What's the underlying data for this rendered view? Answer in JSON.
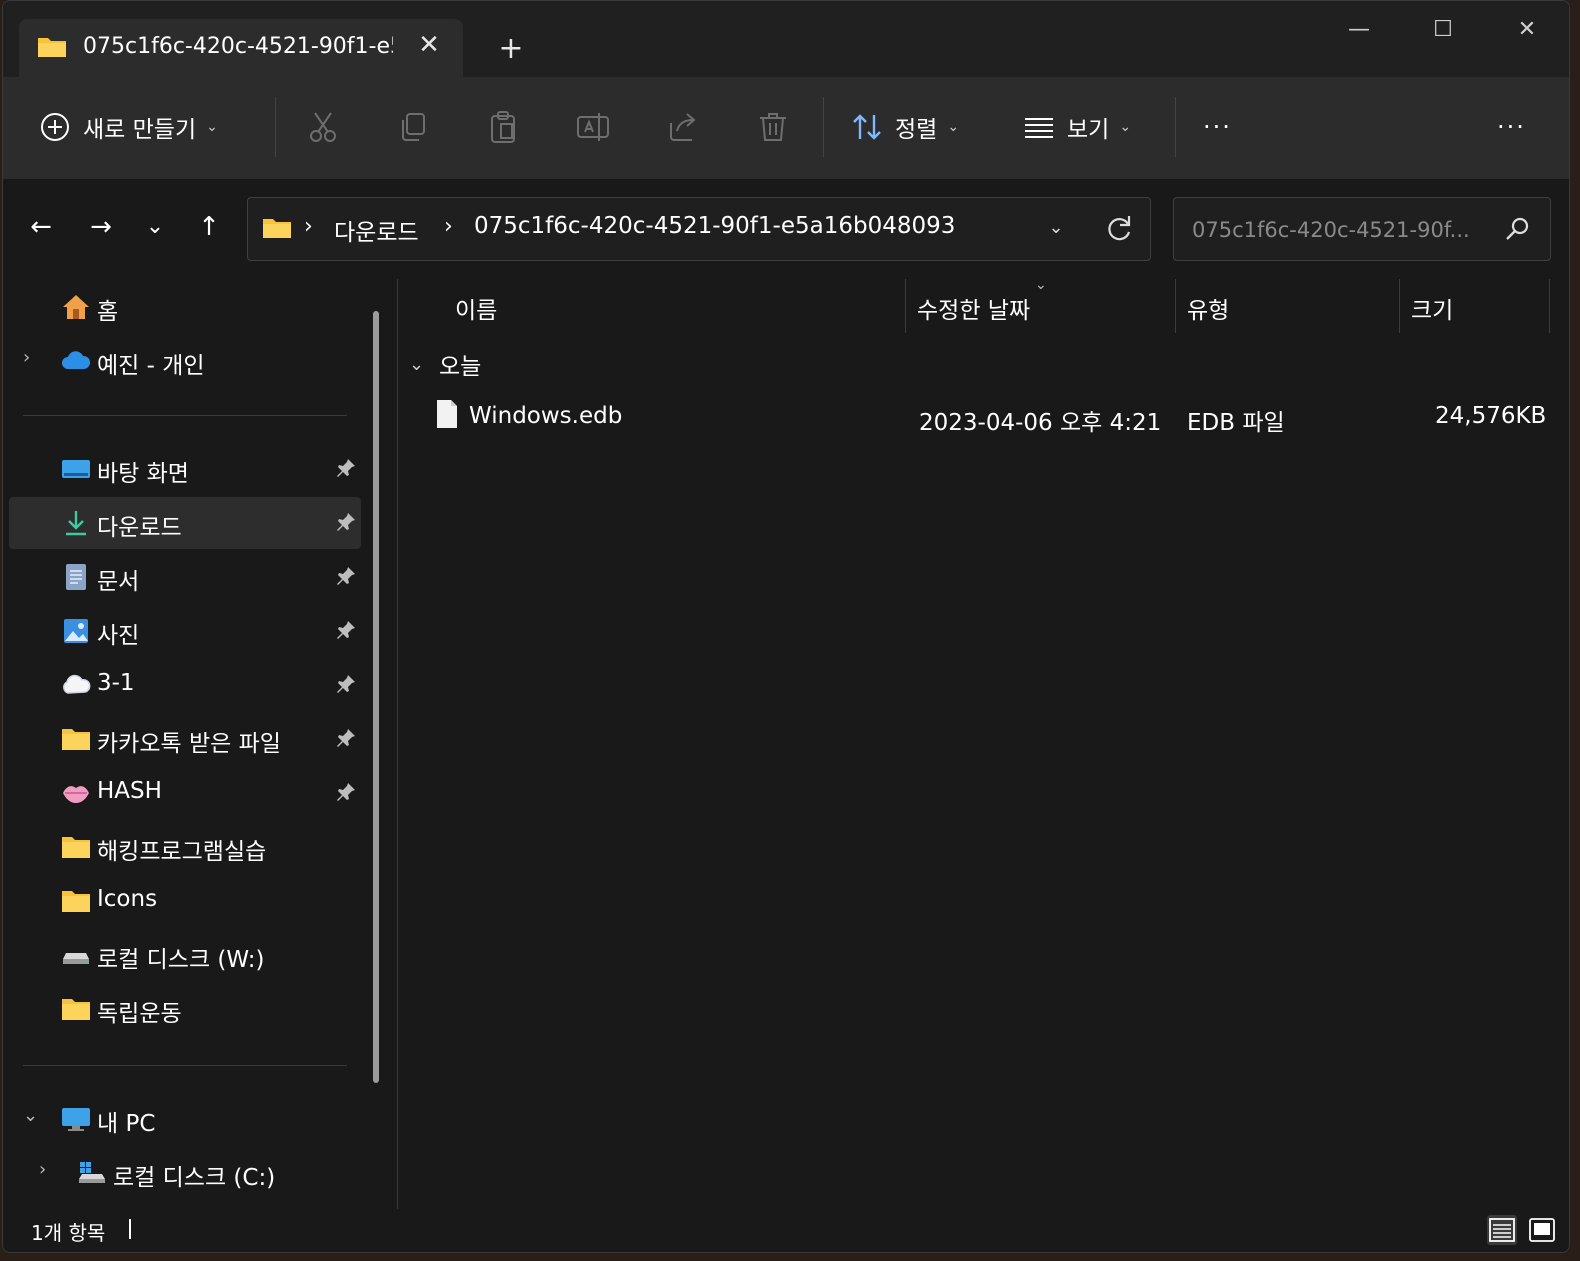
{
  "tab": {
    "title": "075c1f6c-420c-4521-90f1-e5a16b048093",
    "close": "✕",
    "new": "+"
  },
  "window_controls": {
    "minimize": "—",
    "maximize": "☐",
    "close": "✕"
  },
  "toolbar": {
    "new_label": "새로 만들기",
    "sort_label": "정렬",
    "view_label": "보기",
    "more": "···",
    "overflow": "···"
  },
  "nav": {
    "back": "←",
    "forward": "→",
    "recent": "⌄",
    "up": "↑",
    "breadcrumb": [
      "다운로드",
      "075c1f6c-420c-4521-90f1-e5a16b048093"
    ],
    "sep": "›",
    "search_placeholder": "075c1f6c-420c-4521-90f..."
  },
  "sidebar": {
    "items": [
      {
        "label": "홈",
        "icon": "home-icon"
      },
      {
        "label": "예진 - 개인",
        "icon": "cloud-icon"
      },
      {
        "label": "바탕 화면",
        "icon": "desktop-icon",
        "pinned": true
      },
      {
        "label": "다운로드",
        "icon": "download-icon",
        "pinned": true,
        "selected": true
      },
      {
        "label": "문서",
        "icon": "document-icon",
        "pinned": true
      },
      {
        "label": "사진",
        "icon": "pictures-icon",
        "pinned": true
      },
      {
        "label": "3-1",
        "icon": "cloud-sticker-icon",
        "pinned": true
      },
      {
        "label": "카카오톡 받은 파일",
        "icon": "folder-icon",
        "pinned": true
      },
      {
        "label": "HASH",
        "icon": "lips-icon",
        "pinned": true
      },
      {
        "label": "해킹프로그램실습",
        "icon": "folder-icon"
      },
      {
        "label": "Icons",
        "icon": "folder-icon"
      },
      {
        "label": "로컬 디스크 (W:)",
        "icon": "drive-icon"
      },
      {
        "label": "독립운동",
        "icon": "folder-icon"
      },
      {
        "label": "내 PC",
        "icon": "pc-icon"
      },
      {
        "label": "로컬 디스크 (C:)",
        "icon": "windows-drive-icon"
      }
    ]
  },
  "list": {
    "columns": {
      "name": "이름",
      "date": "수정한 날짜",
      "type": "유형",
      "size": "크기"
    },
    "group": "오늘",
    "rows": [
      {
        "name": "Windows.edb",
        "date": "2023-04-06 오후 4:21",
        "type": "EDB 파일",
        "size": "24,576KB"
      }
    ]
  },
  "status": {
    "count": "1개 항목"
  },
  "colors": {
    "background": "#191919",
    "toolbar": "#2c2c2c",
    "selected": "#2d2d2d",
    "folder": "#f8c33a"
  }
}
